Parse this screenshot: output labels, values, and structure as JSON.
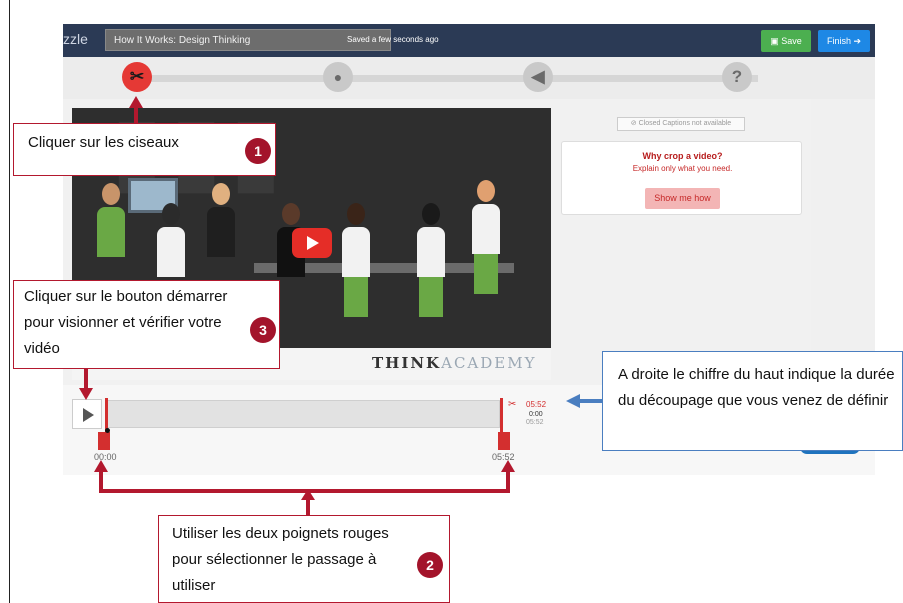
{
  "app": {
    "brand": "zzle",
    "title": "How It Works: Design Thinking",
    "save_status": "Saved a few seconds ago",
    "save_label": "Save",
    "finish_label": "Finish"
  },
  "steps": [
    {
      "name": "crop",
      "icon": "scissors-icon",
      "glyph": "✂",
      "active": true
    },
    {
      "name": "voice",
      "icon": "microphone-icon",
      "glyph": "🎤",
      "active": false
    },
    {
      "name": "audio",
      "icon": "speaker-icon",
      "glyph": "◀",
      "active": false
    },
    {
      "name": "quiz",
      "icon": "question-icon",
      "glyph": "?",
      "active": false
    }
  ],
  "video": {
    "logo_a": "THINK",
    "logo_b": "ACADEMY"
  },
  "sidebar": {
    "captions": "⊘ Closed Captions not available",
    "card_title": "Why crop a video?",
    "card_subtitle": "Explain only what you need.",
    "card_button": "Show me how"
  },
  "timeline": {
    "start": "00:00",
    "end": "05:52",
    "crop_duration": "05:52",
    "current": "0:00",
    "total": "05:52",
    "scissors": "✂"
  },
  "callouts": {
    "c1": {
      "text": "Cliquer sur les ciseaux",
      "num": "1"
    },
    "c2": {
      "text": "Utiliser les deux poignets rouges pour sélectionner le passage à utiliser",
      "num": "2"
    },
    "c3": {
      "text": "Cliquer sur le bouton démarrer pour visionner et vérifier votre vidéo",
      "num": "3"
    },
    "right": {
      "text": "A droite le chiffre du haut indique la durée du découpage que vous venez de définir"
    }
  },
  "colors": {
    "accent_red": "#a3142b",
    "topbar": "#2b3a55",
    "save": "#4caf50",
    "finish": "#1e88e5",
    "arrow_blue": "#4a7ec0"
  }
}
